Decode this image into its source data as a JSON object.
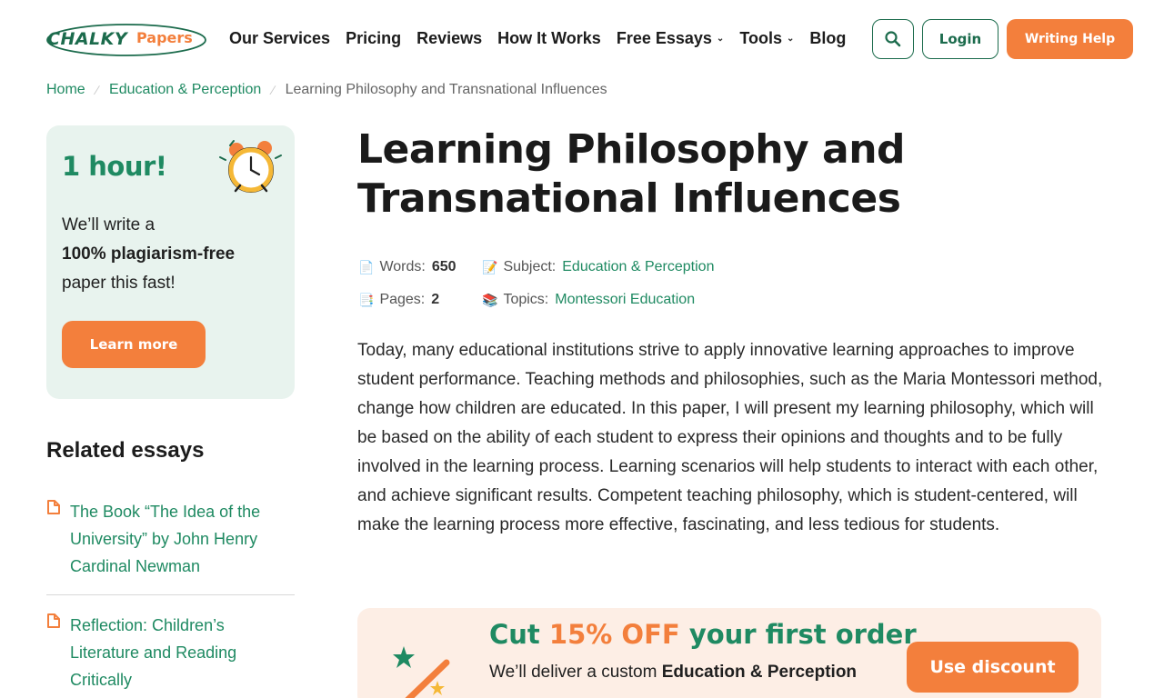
{
  "brand": {
    "logo_part1": "CHALKY",
    "logo_part2": "Papers",
    "green": "#1b6b4c",
    "orange": "#f37f3c"
  },
  "nav": {
    "items": [
      {
        "label": "Our Services",
        "dropdown": false
      },
      {
        "label": "Pricing",
        "dropdown": false
      },
      {
        "label": "Reviews",
        "dropdown": false
      },
      {
        "label": "How It Works",
        "dropdown": false
      },
      {
        "label": "Free Essays",
        "dropdown": true
      },
      {
        "label": "Tools",
        "dropdown": true
      },
      {
        "label": "Blog",
        "dropdown": false
      }
    ],
    "search_icon": "search-icon",
    "login_label": "Login",
    "cta_label": "Writing Help"
  },
  "breadcrumb": {
    "home": "Home",
    "category": "Education & Perception",
    "current": "Learning Philosophy and Transnational Influences"
  },
  "promo": {
    "title": "1 hour!",
    "line1": "We’ll write a",
    "line2_bold": "100% plagiarism-free",
    "line3": "paper this fast!",
    "button": "Learn more"
  },
  "related": {
    "title": "Related essays",
    "items": [
      "The Book “The Idea of the University” by John Henry Cardinal Newman",
      "Reflection: Children’s Literature and Reading Critically"
    ]
  },
  "article": {
    "title": "Learning Philosophy and Transnational Influences",
    "meta": {
      "words_label": "Words:",
      "words_value": "650",
      "pages_label": "Pages:",
      "pages_value": "2",
      "subject_label": "Subject:",
      "subject_value": "Education & Perception",
      "topics_label": "Topics:",
      "topics_value": "Montessori Education"
    },
    "body": "Today, many educational institutions strive to apply innovative learning approaches to improve student performance. Teaching methods and philosophies, such as the Maria Montessori method, change how children are educated. In this paper, I will present my learning philosophy, which will be based on the ability of each student to express their opinions and thoughts and to be fully involved in the learning process. Learning scenarios will help students to interact with each other, and achieve significant results. Competent teaching philosophy, which is student-centered, will make the learning process more effective, fascinating, and less tedious for students."
  },
  "discount": {
    "title_prefix": "Cut",
    "title_accent": "15% OFF",
    "title_suffix": "your first order",
    "sub_prefix": "We’ll deliver a custom",
    "sub_bold": "Education & Perception",
    "button": "Use discount"
  }
}
